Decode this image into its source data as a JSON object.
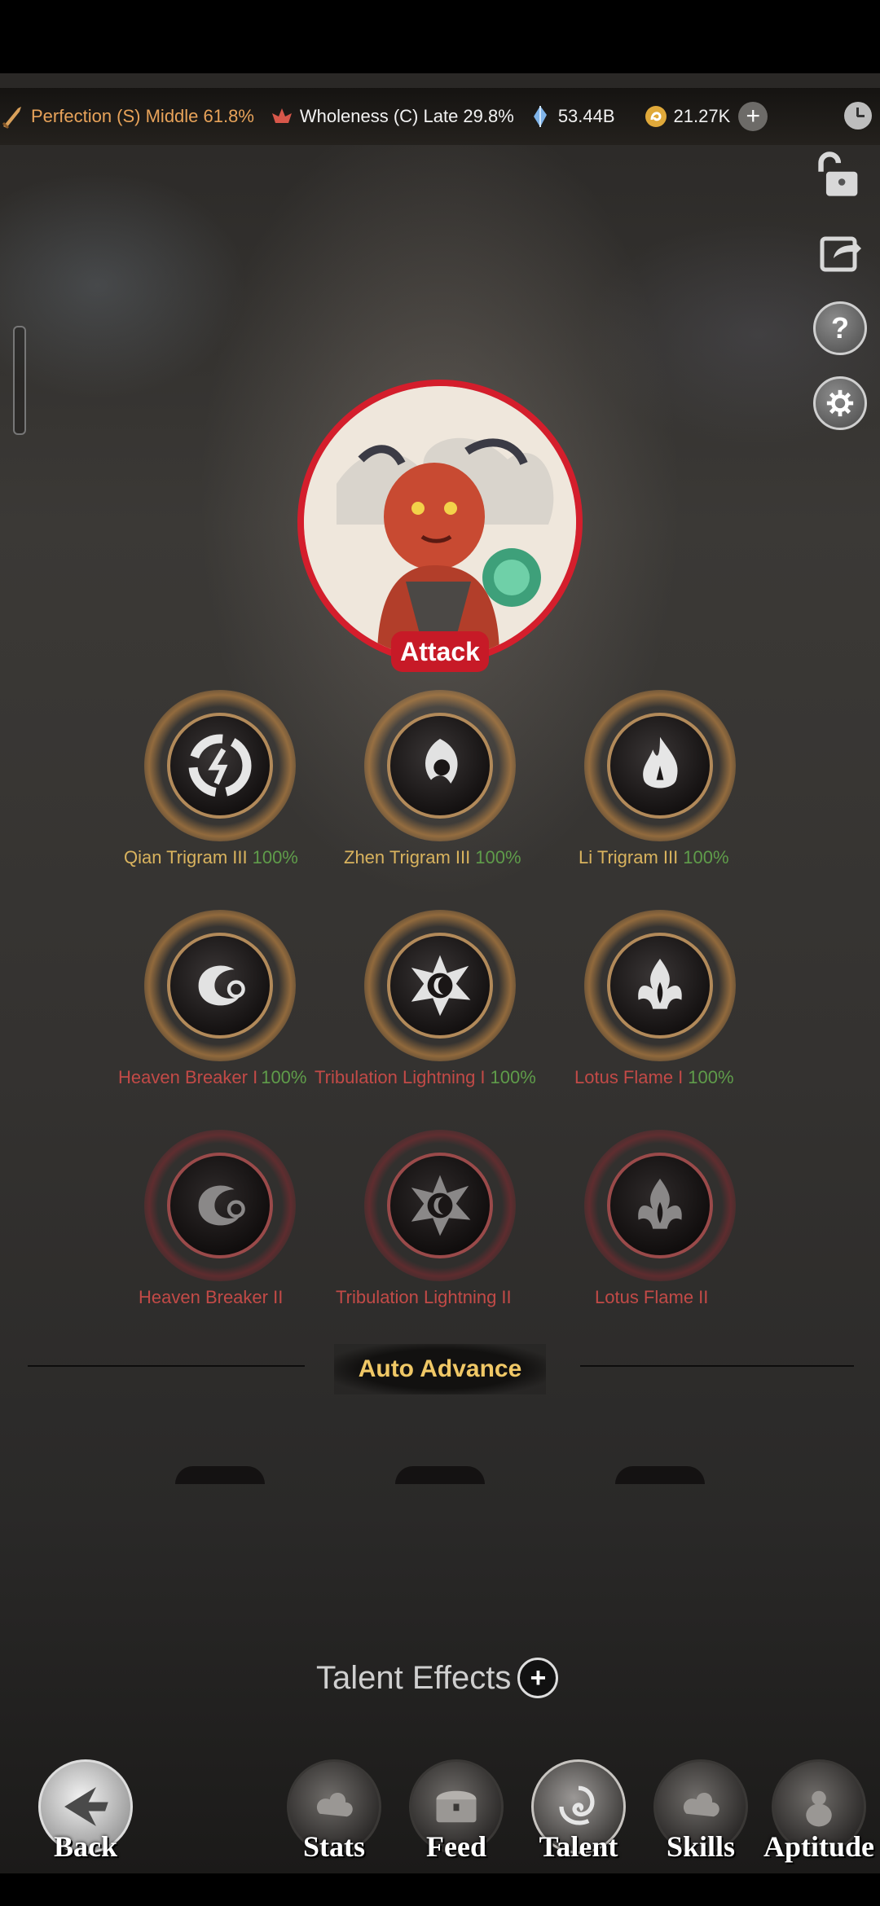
{
  "topbar": {
    "perfection": "Perfection (S) Middle 61.8%",
    "wholeness": "Wholeness (C) Late 29.8%",
    "crystals": "53.44B",
    "coins": "21.27K",
    "plus_label": "+"
  },
  "side_buttons": {
    "help_label": "?"
  },
  "character": {
    "role_label": "Attack"
  },
  "talent_nodes": [
    {
      "name": "Qian Trigram III",
      "progress": "100%",
      "state": "unlocked"
    },
    {
      "name": "Zhen Trigram III",
      "progress": "100%",
      "state": "unlocked"
    },
    {
      "name": "Li Trigram III",
      "progress": "100%",
      "state": "unlocked"
    },
    {
      "name": "Heaven Breaker I",
      "progress": "100%",
      "state": "unlocked"
    },
    {
      "name": "Tribulation Lightning I",
      "progress": "100%",
      "state": "unlocked"
    },
    {
      "name": "Lotus Flame I",
      "progress": "100%",
      "state": "unlocked"
    },
    {
      "name": "Heaven Breaker II",
      "progress": "",
      "state": "locked"
    },
    {
      "name": "Tribulation Lightning II",
      "progress": "",
      "state": "locked"
    },
    {
      "name": "Lotus Flame II",
      "progress": "",
      "state": "locked"
    }
  ],
  "auto_advance_label": "Auto Advance",
  "talent_effects": {
    "label": "Talent Effects",
    "plus": "+"
  },
  "nav": {
    "back": "Back",
    "stats": "Stats",
    "feed": "Feed",
    "talent": "Talent",
    "skills": "Skills",
    "aptitude": "Aptitude",
    "active": "Talent"
  },
  "colors": {
    "accent_gold": "#d9b35e",
    "locked_red": "#c24a47",
    "progress_green": "#5f9c4a",
    "attack_red": "#c71a27"
  }
}
